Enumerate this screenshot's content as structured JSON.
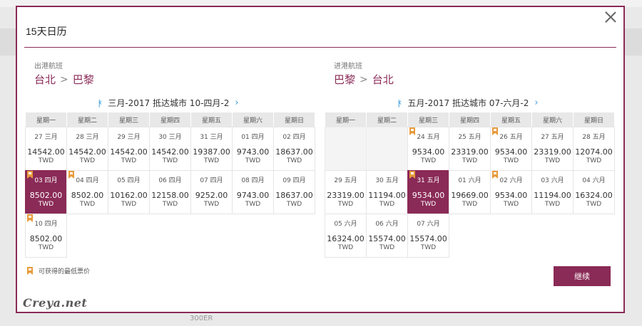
{
  "background": {
    "footer_text": "300ER"
  },
  "modal": {
    "title": "15天日历",
    "continue_label": "继续",
    "legend_text": "可获得的最低票价",
    "watermark": "Creya.net"
  },
  "outbound": {
    "direction_label": "出港航班",
    "origin": "台北",
    "destination": "巴黎",
    "route_separator": ">",
    "month_label": "三月-2017 抵达城市 10-四月-2",
    "weekdays": [
      "星期一",
      "星期二",
      "星期三",
      "星期四",
      "星期五",
      "星期六",
      "星期日"
    ],
    "cells": [
      {
        "date": "27 三月",
        "price": "14542.00",
        "currency": "TWD",
        "lowest": false,
        "selected": false
      },
      {
        "date": "28 三月",
        "price": "14542.00",
        "currency": "TWD",
        "lowest": false,
        "selected": false
      },
      {
        "date": "29 三月",
        "price": "14542.00",
        "currency": "TWD",
        "lowest": false,
        "selected": false
      },
      {
        "date": "30 三月",
        "price": "14542.00",
        "currency": "TWD",
        "lowest": false,
        "selected": false
      },
      {
        "date": "31 三月",
        "price": "19387.00",
        "currency": "TWD",
        "lowest": false,
        "selected": false
      },
      {
        "date": "01 四月",
        "price": "9743.00",
        "currency": "TWD",
        "lowest": false,
        "selected": false
      },
      {
        "date": "02 四月",
        "price": "18637.00",
        "currency": "TWD",
        "lowest": false,
        "selected": false
      },
      {
        "date": "03 四月",
        "price": "8502.00",
        "currency": "TWD",
        "lowest": true,
        "selected": true
      },
      {
        "date": "04 四月",
        "price": "8502.00",
        "currency": "TWD",
        "lowest": true,
        "selected": false
      },
      {
        "date": "05 四月",
        "price": "10162.00",
        "currency": "TWD",
        "lowest": false,
        "selected": false
      },
      {
        "date": "06 四月",
        "price": "12158.00",
        "currency": "TWD",
        "lowest": false,
        "selected": false
      },
      {
        "date": "07 四月",
        "price": "9252.00",
        "currency": "TWD",
        "lowest": false,
        "selected": false
      },
      {
        "date": "08 四月",
        "price": "9743.00",
        "currency": "TWD",
        "lowest": false,
        "selected": false
      },
      {
        "date": "09 四月",
        "price": "18637.00",
        "currency": "TWD",
        "lowest": false,
        "selected": false
      },
      {
        "date": "10 四月",
        "price": "8502.00",
        "currency": "TWD",
        "lowest": true,
        "selected": false
      }
    ]
  },
  "inbound": {
    "direction_label": "进港航班",
    "origin": "巴黎",
    "destination": "台北",
    "route_separator": ">",
    "month_label": "五月-2017 抵达城市 07-六月-2",
    "weekdays": [
      "星期一",
      "星期二",
      "星期三",
      "星期四",
      "星期五",
      "星期六",
      "星期日"
    ],
    "cells": [
      {
        "empty": true
      },
      {
        "empty": true
      },
      {
        "date": "24 五月",
        "price": "9534.00",
        "currency": "TWD",
        "lowest": true,
        "selected": false
      },
      {
        "date": "25 五月",
        "price": "23319.00",
        "currency": "TWD",
        "lowest": false,
        "selected": false
      },
      {
        "date": "26 五月",
        "price": "9534.00",
        "currency": "TWD",
        "lowest": true,
        "selected": false
      },
      {
        "date": "27 五月",
        "price": "23319.00",
        "currency": "TWD",
        "lowest": false,
        "selected": false
      },
      {
        "date": "28 五月",
        "price": "12074.00",
        "currency": "TWD",
        "lowest": false,
        "selected": false
      },
      {
        "date": "29 五月",
        "price": "23319.00",
        "currency": "TWD",
        "lowest": false,
        "selected": false
      },
      {
        "date": "30 五月",
        "price": "11194.00",
        "currency": "TWD",
        "lowest": false,
        "selected": false
      },
      {
        "date": "31 五月",
        "price": "9534.00",
        "currency": "TWD",
        "lowest": true,
        "selected": true
      },
      {
        "date": "01 六月",
        "price": "19669.00",
        "currency": "TWD",
        "lowest": false,
        "selected": false
      },
      {
        "date": "02 六月",
        "price": "9534.00",
        "currency": "TWD",
        "lowest": true,
        "selected": false
      },
      {
        "date": "03 六月",
        "price": "11194.00",
        "currency": "TWD",
        "lowest": false,
        "selected": false
      },
      {
        "date": "04 六月",
        "price": "16324.00",
        "currency": "TWD",
        "lowest": false,
        "selected": false
      },
      {
        "date": "05 六月",
        "price": "16324.00",
        "currency": "TWD",
        "lowest": false,
        "selected": false
      },
      {
        "date": "06 六月",
        "price": "15574.00",
        "currency": "TWD",
        "lowest": false,
        "selected": false
      },
      {
        "date": "07 六月",
        "price": "15574.00",
        "currency": "TWD",
        "lowest": false,
        "selected": false
      }
    ]
  },
  "colors": {
    "accent": "#8a2a57",
    "lowest_marker": "#e89b3c",
    "nav_arrow": "#3a9ad9"
  }
}
